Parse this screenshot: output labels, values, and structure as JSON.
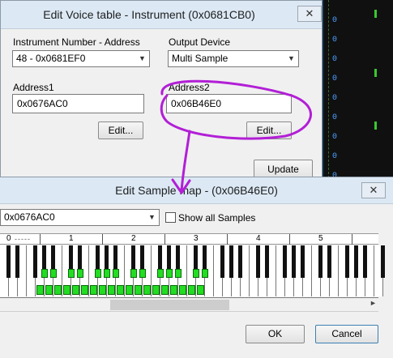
{
  "bg_numbers": [
    "0",
    "0",
    "0",
    "0",
    "0",
    "0",
    "0",
    "0",
    "0"
  ],
  "voice_window": {
    "title": "Edit Voice table - Instrument (0x0681CB0)",
    "close_icon": "close-icon",
    "instrument_label": "Instrument Number - Address",
    "instrument_value": "48 - 0x0681EF0",
    "output_label": "Output Device",
    "output_value": "Multi Sample",
    "address1_label": "Address1",
    "address1_value": "0x0676AC0",
    "address2_label": "Address2",
    "address2_value": "0x06B46E0",
    "edit1_label": "Edit...",
    "edit2_label": "Edit...",
    "update_label": "Update"
  },
  "sample_window": {
    "title": "Edit Sample map -  (0x06B46E0)",
    "close_icon": "close-icon",
    "combo_value": "0x0676AC0",
    "show_all_label": "Show all Samples",
    "ruler_labels": [
      "0",
      "1",
      "2",
      "3",
      "4",
      "5"
    ],
    "ok_label": "OK",
    "cancel_label": "Cancel"
  },
  "colors": {
    "annotation": "#b21fd6",
    "sample_cell": "#22dd22",
    "titlebar": "#dce9f5"
  }
}
